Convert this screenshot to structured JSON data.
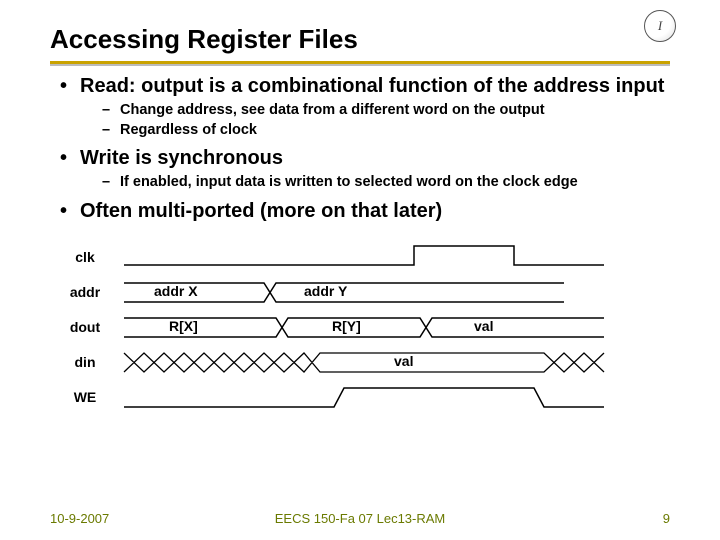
{
  "title": "Accessing Register Files",
  "logo_text": "I",
  "bullets": [
    {
      "text": "Read: output is a combinational function of the address input",
      "sub": [
        "Change address, see data from a different word on the output",
        "Regardless of clock"
      ]
    },
    {
      "text": "Write is synchronous",
      "sub": [
        "If enabled, input data is written to selected word on the clock edge"
      ]
    },
    {
      "text": "Often multi-ported (more on that later)",
      "sub": []
    }
  ],
  "timing": {
    "signals": [
      "clk",
      "addr",
      "dout",
      "din",
      "WE"
    ],
    "addr_labels": {
      "seg1": "addr X",
      "seg2": "addr Y"
    },
    "dout_labels": {
      "seg1": "R[X]",
      "seg2": "R[Y]",
      "seg3": "val"
    },
    "din_label": "val"
  },
  "footer": {
    "left": "10-9-2007",
    "center": "EECS 150-Fa 07 Lec13-RAM",
    "right": "9"
  }
}
